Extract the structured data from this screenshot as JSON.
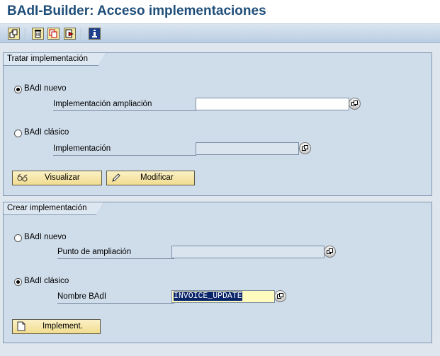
{
  "window": {
    "title": "BAdI-Builder: Acceso implementaciones"
  },
  "toolbar": {
    "icons": [
      "other-object-icon",
      "delete-icon",
      "copy-icon",
      "rename-icon",
      "info-icon"
    ]
  },
  "tratar": {
    "title": "Tratar implementación",
    "new_badi": {
      "label": "BAdI nuevo",
      "selected": true
    },
    "impl_ampl_label": "Implementación ampliación",
    "impl_ampl_value": "",
    "classic_badi": {
      "label": "BAdI clásico",
      "selected": false
    },
    "impl_label": "Implementación",
    "impl_value": "",
    "display_button": "Visualizar",
    "change_button": "Modificar"
  },
  "crear": {
    "title": "Crear implementación",
    "new_badi": {
      "label": "BAdI nuevo",
      "selected": false
    },
    "enh_spot_label": "Punto de ampliación",
    "enh_spot_value": "",
    "classic_badi": {
      "label": "BAdI clásico",
      "selected": true
    },
    "badi_name_label": "Nombre BAdI",
    "badi_name_value": "INVOICE_UPDATE",
    "implement_button": "Implement."
  },
  "colors": {
    "title": "#1f4e7a",
    "panel": "#cfdcea",
    "button": "#f1dc8f",
    "selection": "#0a246a"
  }
}
